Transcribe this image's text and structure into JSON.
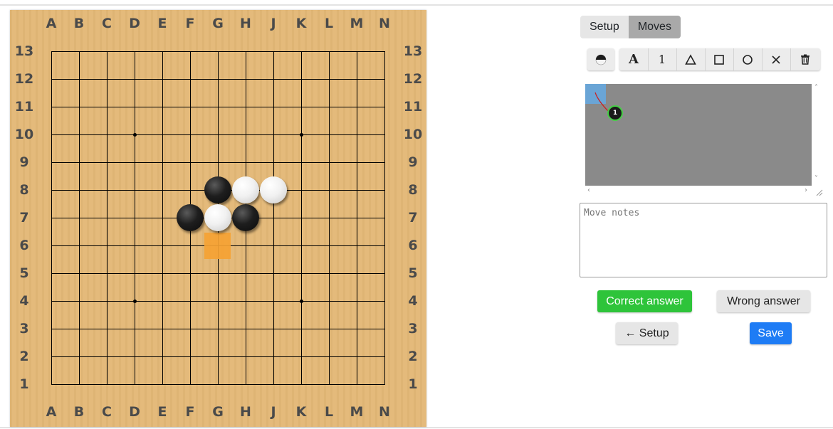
{
  "board": {
    "columns": [
      "A",
      "B",
      "C",
      "D",
      "E",
      "F",
      "G",
      "H",
      "J",
      "K",
      "L",
      "M",
      "N"
    ],
    "rows": [
      "13",
      "12",
      "11",
      "10",
      "9",
      "8",
      "7",
      "6",
      "5",
      "4",
      "3",
      "2",
      "1"
    ],
    "stones": [
      {
        "color": "black",
        "point": "G8"
      },
      {
        "color": "white",
        "point": "H8"
      },
      {
        "color": "white",
        "point": "J8"
      },
      {
        "color": "black",
        "point": "F7"
      },
      {
        "color": "white",
        "point": "G7"
      },
      {
        "color": "black",
        "point": "H7"
      }
    ],
    "highlight": {
      "point": "G6",
      "color": "#f5a233"
    },
    "hoshi": [
      "D10",
      "K10",
      "D4",
      "K4"
    ]
  },
  "tabs": {
    "setup": "Setup",
    "moves": "Moves",
    "active": "Moves"
  },
  "toolbar": {
    "color_toggle_icon": "half-black-half-white-stone-icon",
    "label_letter": "A",
    "label_number": "1",
    "triangle_icon": "△",
    "square_icon": "□",
    "circle_icon": "○",
    "cross_icon": "✕",
    "delete_icon": "trash-icon"
  },
  "tree": {
    "move_label": "1",
    "stone_color": "black",
    "current_ring_color": "#45d045"
  },
  "notes": {
    "placeholder": "Move notes"
  },
  "buttons": {
    "correct": "Correct answer",
    "wrong": "Wrong answer",
    "back_setup": "← Setup",
    "save": "Save"
  },
  "colors": {
    "board": "#e3b877",
    "correct": "#2ec43a",
    "save": "#1e7cf5",
    "tree_bg": "#8a8a8a",
    "tree_selection": "#6aa5d6"
  }
}
